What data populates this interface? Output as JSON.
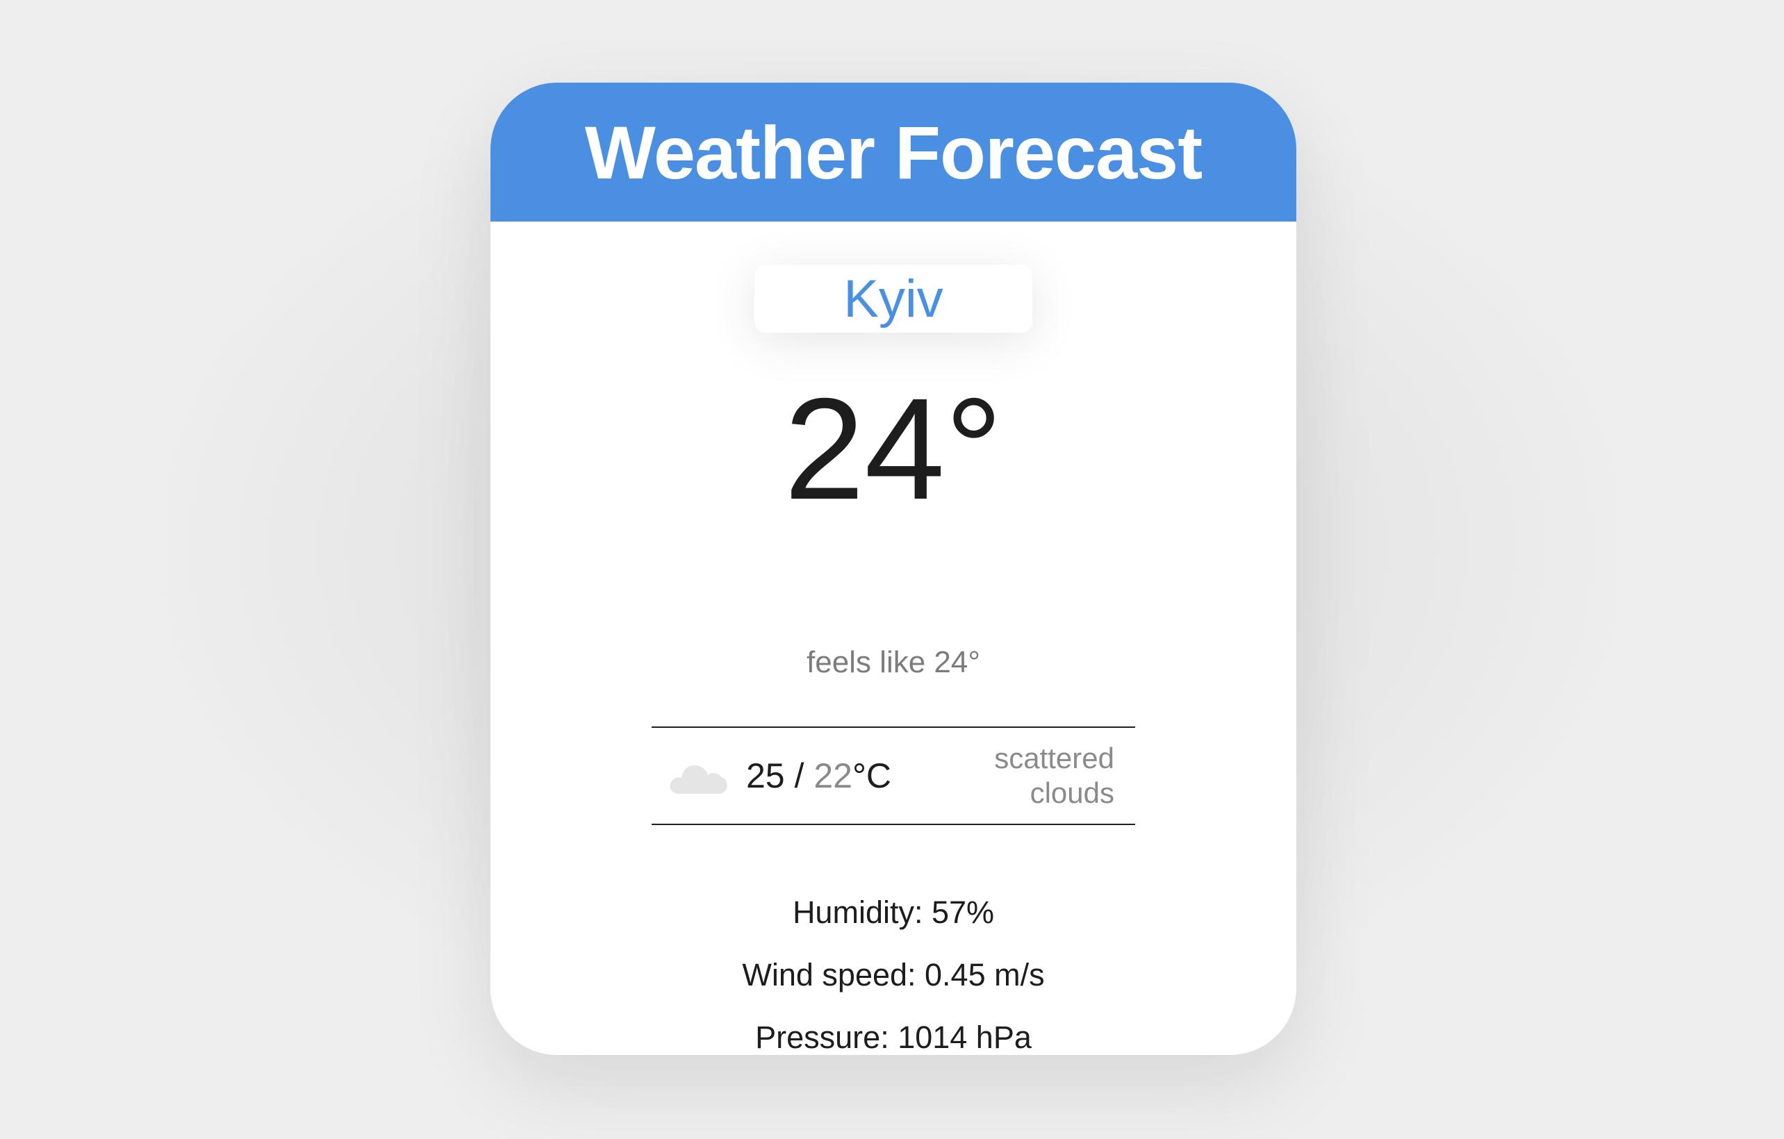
{
  "header": {
    "title": "Weather Forecast"
  },
  "city": {
    "name": "Kyiv"
  },
  "current": {
    "temp": "24°",
    "feels_like": "feels like 24°"
  },
  "summary": {
    "icon": "cloud-icon",
    "high": "25",
    "separator": " / ",
    "low": "22",
    "unit": "°C",
    "description": "scattered clouds"
  },
  "details": {
    "humidity": "Humidity: 57%",
    "wind": "Wind speed: 0.45 m/s",
    "pressure": "Pressure: 1014 hPa"
  },
  "colors": {
    "accent": "#4b8fe3",
    "background": "#eeeeee",
    "card": "#ffffff",
    "muted_text": "#7c7c7c"
  }
}
